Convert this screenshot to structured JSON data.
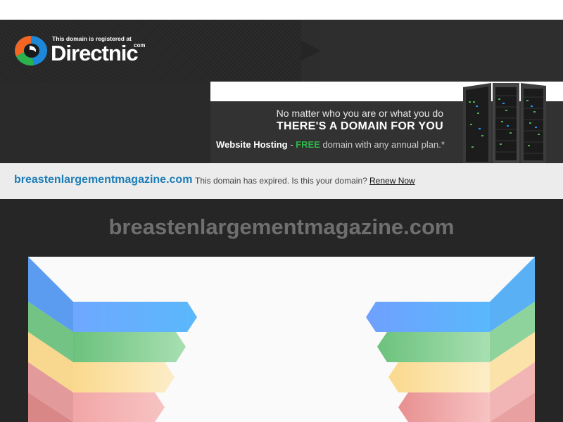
{
  "header": {
    "registered_text": "This domain is registered at",
    "brand": "Directnic",
    "brand_suffix": "com"
  },
  "banner": {
    "line1": "No matter who you are or what you do",
    "line2": "THERE'S A DOMAIN FOR YOU",
    "hosting_label": "Website Hosting",
    "dash": " - ",
    "free_label": "FREE",
    "rest": " domain with any annual plan.*"
  },
  "expired": {
    "domain": "breastenlargementmagazine.com",
    "message": "This domain has expired. Is this your domain?",
    "renew_label": "Renew Now"
  },
  "main": {
    "title": "breastenlargementmagazine.com"
  },
  "colors": {
    "header_bg": "#2e2d2d",
    "link_blue": "#1b7db8",
    "free_green": "#2fb34a",
    "ribbon_blue": "#5aa9f8",
    "ribbon_green": "#7ccb8c",
    "ribbon_yellow": "#fbe3a6",
    "ribbon_red": "#ef9e9e"
  }
}
